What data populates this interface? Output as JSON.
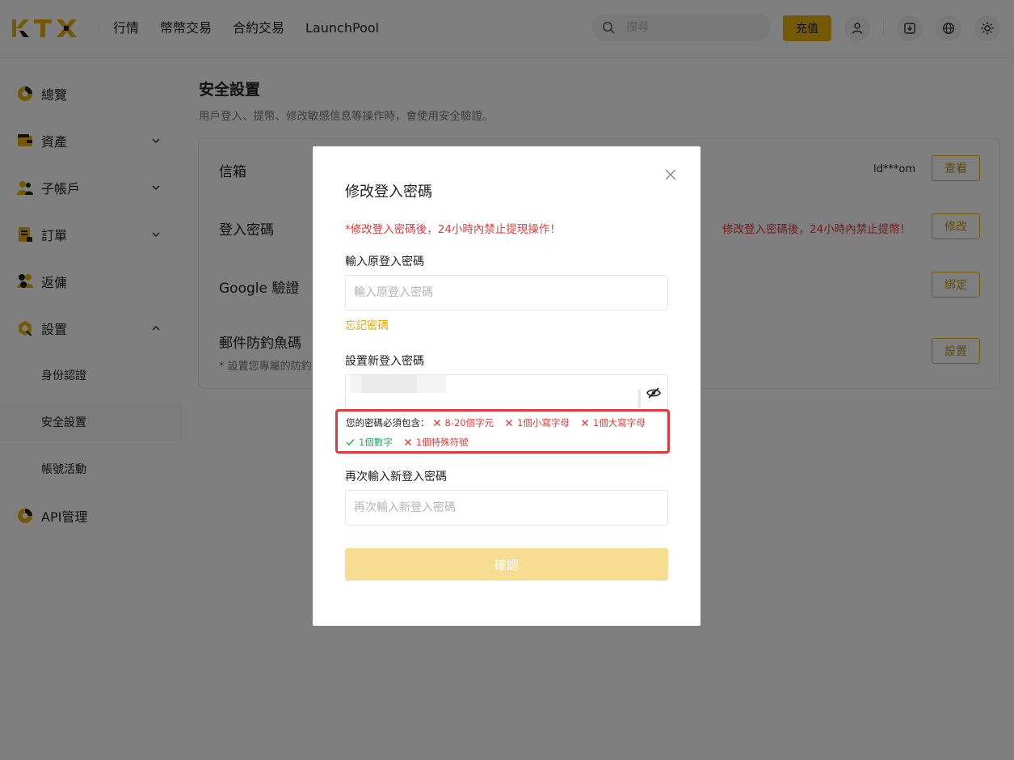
{
  "header": {
    "logo": "KTX",
    "nav": [
      "行情",
      "幣幣交易",
      "合約交易",
      "LaunchPool"
    ],
    "search_placeholder": "搜尋",
    "deposit_label": "充值",
    "icons": [
      "user-icon",
      "download-icon",
      "globe-icon",
      "sun-icon"
    ]
  },
  "sidebar": {
    "items": [
      {
        "label": "總覽",
        "icon": "overview-icon",
        "expandable": false
      },
      {
        "label": "資產",
        "icon": "wallet-icon",
        "expandable": true,
        "expanded": false
      },
      {
        "label": "子帳戶",
        "icon": "subaccount-icon",
        "expandable": true,
        "expanded": false
      },
      {
        "label": "訂單",
        "icon": "orders-icon",
        "expandable": true,
        "expanded": false
      },
      {
        "label": "返傭",
        "icon": "rebate-icon",
        "expandable": false
      },
      {
        "label": "設置",
        "icon": "settings-icon",
        "expandable": true,
        "expanded": true
      }
    ],
    "sub_items": [
      {
        "label": "身份認證",
        "active": false
      },
      {
        "label": "安全設置",
        "active": true
      },
      {
        "label": "帳號活動",
        "active": false
      }
    ],
    "last_item": {
      "label": "API管理",
      "icon": "api-icon"
    }
  },
  "main": {
    "title": "安全設置",
    "description": "用戶登入、提幣、修改敏感信息等操作時，會使用安全驗證。",
    "rows": [
      {
        "title": "信箱",
        "subtitle": "",
        "value": "ld***om",
        "button": "查看"
      },
      {
        "title": "登入密碼",
        "subtitle": "",
        "value": "修改登入密碼後，24小時內禁止提幣！",
        "button": "修改"
      },
      {
        "title": "Google 驗證",
        "subtitle": "",
        "value": "",
        "button": "綁定"
      },
      {
        "title": "郵件防釣魚碼",
        "subtitle": "* 設置您專屬的防釣",
        "value": "",
        "button": "設置"
      }
    ]
  },
  "modal": {
    "title": "修改登入密碼",
    "warning": "*修改登入密碼後，24小時內禁止提現操作！",
    "old_password_label": "輸入原登入密碼",
    "old_password_placeholder": "輸入原登入密碼",
    "forgot_label": "忘記密碼",
    "new_password_label": "設置新登入密碼",
    "rules_heading": "您的密碼必須包含：",
    "rules": [
      {
        "text": "8-20個字元",
        "ok": false
      },
      {
        "text": "1個小寫字母",
        "ok": false
      },
      {
        "text": "1個大寫字母",
        "ok": false
      },
      {
        "text": "1個數字",
        "ok": true
      },
      {
        "text": "1個特殊符號",
        "ok": false
      }
    ],
    "repeat_label": "再次輸入新登入密碼",
    "repeat_placeholder": "再次輸入新登入密碼",
    "confirm_label": "確認"
  },
  "colors": {
    "accent": "#e6b00a",
    "error": "#e03c3c",
    "success": "#2aa86a",
    "confirm_disabled": "#f7dd92"
  }
}
